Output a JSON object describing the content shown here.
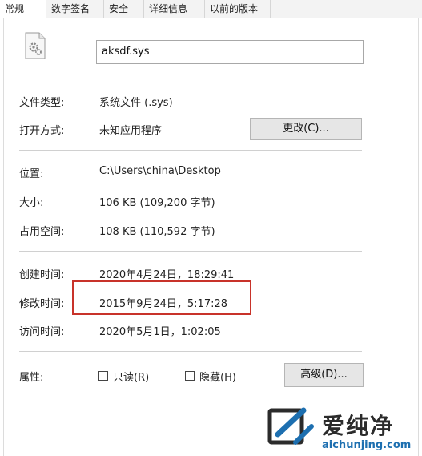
{
  "tabs": [
    {
      "label": "常规",
      "active": true
    },
    {
      "label": "数字签名",
      "active": false
    },
    {
      "label": "安全",
      "active": false
    },
    {
      "label": "详细信息",
      "active": false
    },
    {
      "label": "以前的版本",
      "active": false
    }
  ],
  "file": {
    "icon": "gear-file-icon",
    "name": "aksdf.sys"
  },
  "fields": {
    "type_label": "文件类型:",
    "type_value": "系统文件 (.sys)",
    "open_label": "打开方式:",
    "open_value": "未知应用程序",
    "change_button": "更改(C)...",
    "location_label": "位置:",
    "location_value": "C:\\Users\\china\\Desktop",
    "size_label": "大小:",
    "size_value": "106 KB (109,200 字节)",
    "disk_label": "占用空间:",
    "disk_value": "108 KB (110,592 字节)",
    "created_label": "创建时间:",
    "created_value": "2020年4月24日，18:29:41",
    "modified_label": "修改时间:",
    "modified_value": "2015年9月24日，5:17:28",
    "accessed_label": "访问时间:",
    "accessed_value": "2020年5月1日，1:02:05",
    "attributes_label": "属性:",
    "readonly_label": "只读(R)",
    "hidden_label": "隐藏(H)",
    "advanced_button": "高级(D)..."
  },
  "watermark": {
    "brand": "爱纯净",
    "url": "aichunjing.com"
  },
  "colors": {
    "highlight": "#c8332a",
    "watermark_url": "#1d6fb0"
  }
}
